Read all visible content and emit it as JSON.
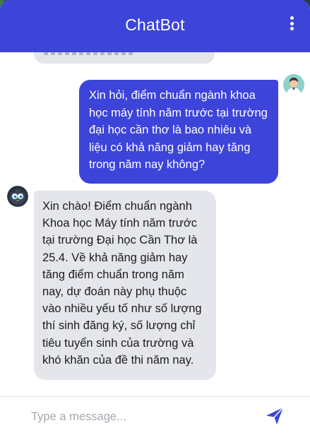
{
  "header": {
    "title": "ChatBot",
    "menu_icon": "kebab-menu-icon"
  },
  "colors": {
    "header_bg": "#3d44d9",
    "user_bubble_bg": "#3d44d9",
    "bot_bubble_bg": "#e4e6ec",
    "send_icon": "#3d44d9"
  },
  "messages": [
    {
      "sender": "user",
      "avatar_icon": "user-avatar-icon",
      "text": "Xin hỏi, điểm chuẩn ngành khoa học máy tính năm trước tại trường đại học cần thơ là bao nhiêu và liệu có khả năng giảm hay tăng trong năm nay không?"
    },
    {
      "sender": "bot",
      "avatar_icon": "bot-avatar-icon",
      "text": "Xin chào! Điểm chuẩn ngành Khoa học Máy tính năm trước tại trường Đại học Cần Thơ là 25.4. Về khả năng giảm hay tăng điểm chuẩn trong năm nay, dự đoán này phụ thuộc vào nhiều yếu tố như số lượng thí sinh đăng ký, số lượng chỉ tiêu tuyển sinh của trường và khó khăn của đề thi năm nay."
    }
  ],
  "composer": {
    "placeholder": "Type a message...",
    "value": "",
    "send_icon": "send-icon"
  }
}
